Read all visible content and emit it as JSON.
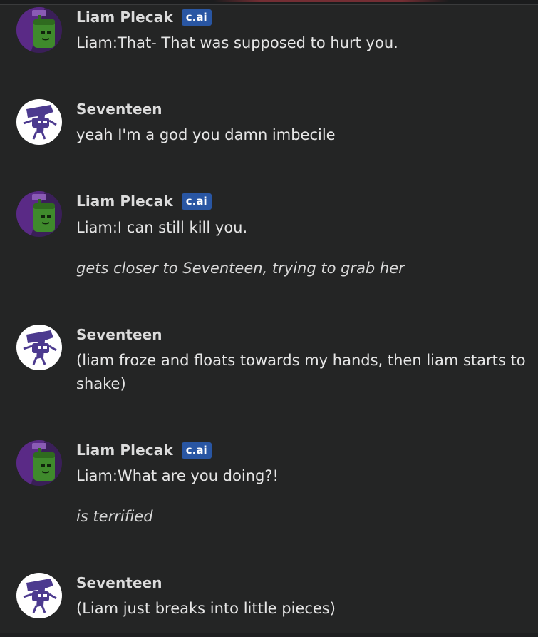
{
  "messages": [
    {
      "sender": "Liam Plecak",
      "badge": "c.ai",
      "avatar_icon": "green-character-avatar",
      "text": "Liam:That- That was supposed to hurt you.",
      "action": ""
    },
    {
      "sender": "Seventeen",
      "badge": "",
      "avatar_icon": "purple-seventeen-avatar",
      "text": "yeah I'm a god you damn imbecile",
      "action": ""
    },
    {
      "sender": "Liam Plecak",
      "badge": "c.ai",
      "avatar_icon": "green-character-avatar",
      "text": "Liam:I can still kill you.",
      "action": "gets closer to Seventeen, trying to grab her"
    },
    {
      "sender": "Seventeen",
      "badge": "",
      "avatar_icon": "purple-seventeen-avatar",
      "text": "(liam froze and floats towards my hands, then liam starts to shake)",
      "action": ""
    },
    {
      "sender": "Liam Plecak",
      "badge": "c.ai",
      "avatar_icon": "green-character-avatar",
      "text": "Liam:What are you doing?!",
      "action": "is terrified"
    },
    {
      "sender": "Seventeen",
      "badge": "",
      "avatar_icon": "purple-seventeen-avatar",
      "text": "(Liam just breaks into little pieces)",
      "action": ""
    }
  ],
  "colors": {
    "background": "#242525",
    "badge": "#2956a3",
    "liam_purple": "#5a2a86",
    "liam_green": "#3f8a2c",
    "seventeen_purple": "#4c3a8f"
  }
}
